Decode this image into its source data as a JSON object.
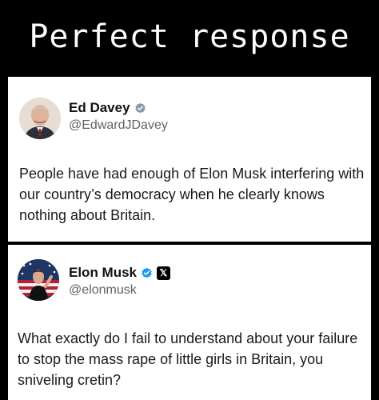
{
  "banner": {
    "title": "Perfect response"
  },
  "tweets": [
    {
      "name": "Ed Davey",
      "handle": "@EdwardJDavey",
      "text": "People have had enough of Elon Musk interfering with our country’s democracy when he clearly knows nothing about Britain.",
      "verified_badge_color": "#829aab"
    },
    {
      "name": "Elon Musk",
      "handle": "@elonmusk",
      "text": "What exactly do I fail to understand about your failure to stop the mass rape of little girls in Britain, you sniveling cretin?",
      "verified_badge_color": "#1d9bf0",
      "affiliate_badge": "𝕏"
    }
  ]
}
